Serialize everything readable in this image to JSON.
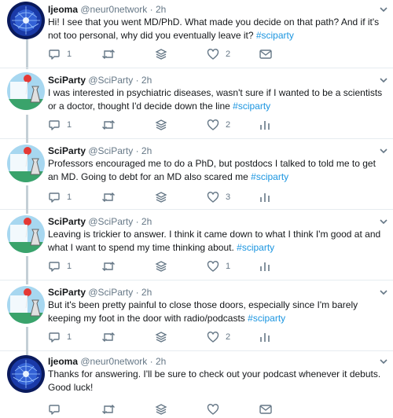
{
  "tweets": [
    {
      "name": "Ijeoma",
      "handle": "@neur0network",
      "dot": "·",
      "time": "2h",
      "text_main": "Hi! I see that you went MD/PhD. What made you decide on that path? And if it's not too personal, why did you eventually leave it?",
      "hashtag": "#sciparty",
      "replies": "1",
      "likes": "2",
      "last_icon": "mail-icon"
    },
    {
      "name": "SciParty",
      "handle": "@SciParty",
      "dot": "·",
      "time": "2h",
      "text_main": "I was interested in psychiatric diseases, wasn't sure if I wanted to be a scientists or a doctor, thought I'd decide down the line",
      "hashtag": "#sciparty",
      "replies": "1",
      "likes": "2",
      "last_icon": "stats-icon"
    },
    {
      "name": "SciParty",
      "handle": "@SciParty",
      "dot": "·",
      "time": "2h",
      "text_main": "Professors encouraged me to do a PhD, but postdocs I talked to told me to get an MD. Going to debt for an MD also scared me",
      "hashtag": "#sciparty",
      "replies": "1",
      "likes": "3",
      "last_icon": "stats-icon"
    },
    {
      "name": "SciParty",
      "handle": "@SciParty",
      "dot": "·",
      "time": "2h",
      "text_main": "Leaving is trickier to answer. I think it came down to what I think I'm good at and what I want to spend my time thinking about.",
      "hashtag": "#sciparty",
      "replies": "1",
      "likes": "1",
      "last_icon": "stats-icon"
    },
    {
      "name": "SciParty",
      "handle": "@SciParty",
      "dot": "·",
      "time": "2h",
      "text_main": "But it's been pretty painful to close those doors, especially since I'm barely keeping my foot in the door with radio/podcasts",
      "hashtag": "#sciparty",
      "replies": "1",
      "likes": "2",
      "last_icon": "stats-icon"
    },
    {
      "name": "Ijeoma",
      "handle": "@neur0network",
      "dot": "·",
      "time": "2h",
      "text_main": "Thanks for answering. I'll be sure to check out your podcast whenever it debuts. Good luck!",
      "hashtag": "",
      "replies": "",
      "likes": "",
      "last_icon": "mail-icon"
    }
  ],
  "colors": {
    "hashtag": "#1b95e0",
    "secondary_text": "#657786",
    "thread_line": "#c4cfd6",
    "divider": "#e6ecf0"
  }
}
